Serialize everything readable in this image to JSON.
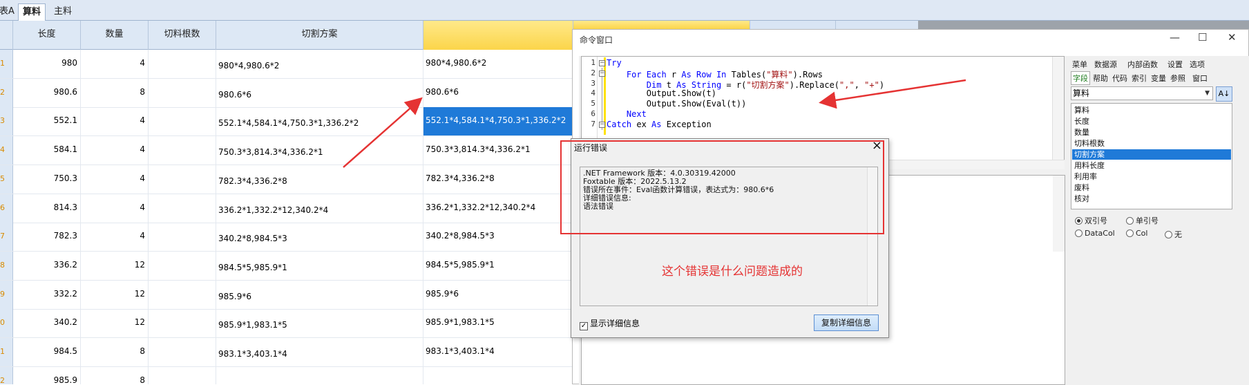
{
  "tabs": [
    "表A",
    "算料",
    "主料"
  ],
  "grid": {
    "headers": [
      "长度",
      "数量",
      "切料根数",
      "切割方案"
    ],
    "rows": [
      {
        "num": "1",
        "length": "980",
        "qty": "4",
        "count": "",
        "plan": "980*4,980.6*2",
        "result": "980*4,980.6*2"
      },
      {
        "num": "2",
        "length": "980.6",
        "qty": "8",
        "count": "",
        "plan": "980.6*6",
        "result": "980.6*6"
      },
      {
        "num": "3",
        "length": "552.1",
        "qty": "4",
        "count": "",
        "plan": "552.1*4,584.1*4,750.3*1,336.2*2",
        "result": "552.1*4,584.1*4,750.3*1,336.2*2"
      },
      {
        "num": "4",
        "length": "584.1",
        "qty": "4",
        "count": "",
        "plan": "750.3*3,814.3*4,336.2*1",
        "result": "750.3*3,814.3*4,336.2*1"
      },
      {
        "num": "5",
        "length": "750.3",
        "qty": "4",
        "count": "",
        "plan": "782.3*4,336.2*8",
        "result": "782.3*4,336.2*8"
      },
      {
        "num": "6",
        "length": "814.3",
        "qty": "4",
        "count": "",
        "plan": "336.2*1,332.2*12,340.2*4",
        "result": "336.2*1,332.2*12,340.2*4"
      },
      {
        "num": "7",
        "length": "782.3",
        "qty": "4",
        "count": "",
        "plan": "340.2*8,984.5*3",
        "result": "340.2*8,984.5*3"
      },
      {
        "num": "8",
        "length": "336.2",
        "qty": "12",
        "count": "",
        "plan": "984.5*5,985.9*1",
        "result": "984.5*5,985.9*1"
      },
      {
        "num": "9",
        "length": "332.2",
        "qty": "12",
        "count": "",
        "plan": "985.9*6",
        "result": "985.9*6"
      },
      {
        "num": "0",
        "length": "340.2",
        "qty": "12",
        "count": "",
        "plan": "985.9*1,983.1*5",
        "result": "985.9*1,983.1*5"
      },
      {
        "num": "1",
        "length": "984.5",
        "qty": "8",
        "count": "",
        "plan": "983.1*3,403.1*4",
        "result": "983.1*3,403.1*4"
      },
      {
        "num": "2",
        "length": "985.9",
        "qty": "8",
        "count": "",
        "plan": "",
        "result": ""
      }
    ]
  },
  "command_window": {
    "title": "命令窗口",
    "code_lines": [
      {
        "num": "1",
        "fold": "⊟",
        "parts": [
          {
            "t": "Try",
            "c": "kw"
          }
        ]
      },
      {
        "num": "2",
        "fold": "⊟",
        "parts": [
          {
            "t": "    For Each ",
            "c": "kw"
          },
          {
            "t": "r ",
            "c": ""
          },
          {
            "t": "As Row In ",
            "c": "kw"
          },
          {
            "t": "Tables(",
            "c": ""
          },
          {
            "t": "\"算料\"",
            "c": "st"
          },
          {
            "t": ").Rows",
            "c": ""
          }
        ]
      },
      {
        "num": "3",
        "fold": "",
        "parts": [
          {
            "t": "        Dim ",
            "c": "kw"
          },
          {
            "t": "t ",
            "c": ""
          },
          {
            "t": "As String ",
            "c": "kw"
          },
          {
            "t": "= r(",
            "c": ""
          },
          {
            "t": "\"切割方案\"",
            "c": "st"
          },
          {
            "t": ").Replace(",
            "c": ""
          },
          {
            "t": "\",\"",
            "c": "st"
          },
          {
            "t": ", ",
            "c": ""
          },
          {
            "t": "\"+\"",
            "c": "st"
          },
          {
            "t": ")",
            "c": ""
          }
        ]
      },
      {
        "num": "4",
        "fold": "",
        "parts": [
          {
            "t": "        Output.Show(t)",
            "c": ""
          }
        ]
      },
      {
        "num": "5",
        "fold": "",
        "parts": [
          {
            "t": "        Output.Show(Eval(t))",
            "c": ""
          }
        ]
      },
      {
        "num": "6",
        "fold": "",
        "parts": [
          {
            "t": "    Next",
            "c": "kw"
          }
        ]
      },
      {
        "num": "7",
        "fold": "⊟",
        "parts": [
          {
            "t": "Catch ",
            "c": "kw"
          },
          {
            "t": "ex ",
            "c": ""
          },
          {
            "t": "As ",
            "c": "kw"
          },
          {
            "t": "Exception",
            "c": ""
          }
        ]
      }
    ],
    "menu_row1": [
      "菜单",
      "数据源",
      "内部函数",
      "设置",
      "选项"
    ],
    "menu_row2": [
      "字段",
      "帮助",
      "代码",
      "索引",
      "变量",
      "参照",
      "窗口"
    ],
    "table_select": "算料",
    "fields": [
      "算料",
      "长度",
      "数量",
      "切料根数",
      "切割方案",
      "用料长度",
      "利用率",
      "废料",
      "核对"
    ],
    "selected_field": "切割方案",
    "radio_row1": [
      "双引号",
      "单引号"
    ],
    "radio_row2": [
      "DataCol",
      "Col",
      "无"
    ]
  },
  "error_dialog": {
    "title": "运行错误",
    "lines": [
      ".NET Framework 版本：4.0.30319.42000",
      "Foxtable 版本：2022.5.13.2",
      "错误所在事件：Eval函数计算错误，表达式为：980.6*6",
      "详细错误信息:",
      "语法错误"
    ],
    "checkbox_label": "显示详细信息",
    "copy_button": "复制详细信息"
  },
  "annotation_text": "这个错误是什么问题造成的",
  "colors": {
    "selection": "#1f7ad8",
    "annotation": "#e53333",
    "header_bg": "#dde8f5",
    "keyword": "#0000ff",
    "string": "#a31515"
  }
}
